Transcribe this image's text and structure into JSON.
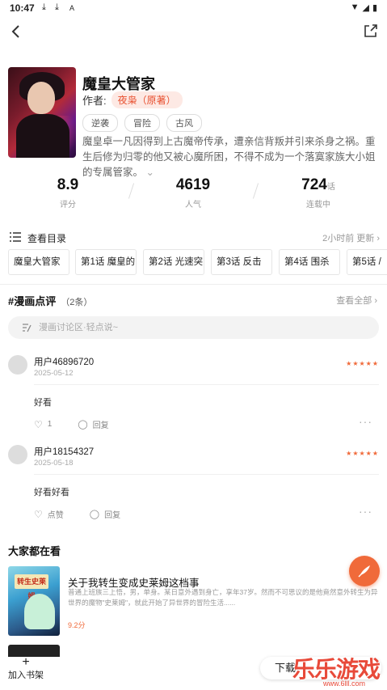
{
  "status": {
    "time": "10:47",
    "download_icons": [
      "download-icon",
      "download-icon",
      "a-icon"
    ],
    "right_icons": [
      "wifi-icon",
      "signal-icon",
      "battery-icon"
    ]
  },
  "book": {
    "title": "魔皇大管家",
    "author_label": "作者:",
    "author": "夜枭（原著）",
    "tags": [
      "逆袭",
      "冒险",
      "古风"
    ],
    "description": "魔皇卓一凡因得到上古魔帝传承，遭亲信背叛并引来杀身之祸。重生后修为归零的他又被心魔所困，不得不成为一个落寞家族大小姐的专属管家。"
  },
  "stats": [
    {
      "value": "8.9",
      "unit": "",
      "label": "评分"
    },
    {
      "value": "4619",
      "unit": "",
      "label": "人气"
    },
    {
      "value": "724",
      "unit": "话",
      "label": "连载中"
    }
  ],
  "catalog": {
    "label": "查看目录",
    "update": "2小时前 更新 ›"
  },
  "chapters": [
    "魔皇大管家",
    "第1话 魔皇的...",
    "第2话 光速突...",
    "第3话 反击",
    "第4话 围杀",
    "第5话 /"
  ],
  "reviews_section": {
    "title": "#漫画点评",
    "count": "（2条）",
    "view_all": "查看全部 ›",
    "input_placeholder": "漫画讨论区·轻点说~"
  },
  "reviews": [
    {
      "user": "用户46896720",
      "date": "2025-05-12",
      "stars": "★★★★★",
      "text": "好看",
      "likes": "1",
      "reply": "回复"
    },
    {
      "user": "用户18154327",
      "date": "2025-05-18",
      "stars": "★★★★★",
      "text": "好看好看",
      "likes": "点赞",
      "reply": "回复"
    }
  ],
  "recommend": {
    "title": "大家都在看",
    "items": [
      {
        "title": "关于我转生变成史莱姆这档事",
        "cover_text": "转生史莱姆",
        "desc": "普通上班族三上悟，男，单身。某日意外遇到身亡，享年37岁。然而不可思议的是他竟然意外转生为异世界的魔物\"史莱姆\"，就此开始了异世界的冒险生活......",
        "score": "9.2分"
      }
    ]
  },
  "bottom": {
    "add_shelf": "加入书架",
    "download": "下载"
  },
  "watermark": {
    "text": "乐乐游戏",
    "url": "www.6lll.com"
  }
}
